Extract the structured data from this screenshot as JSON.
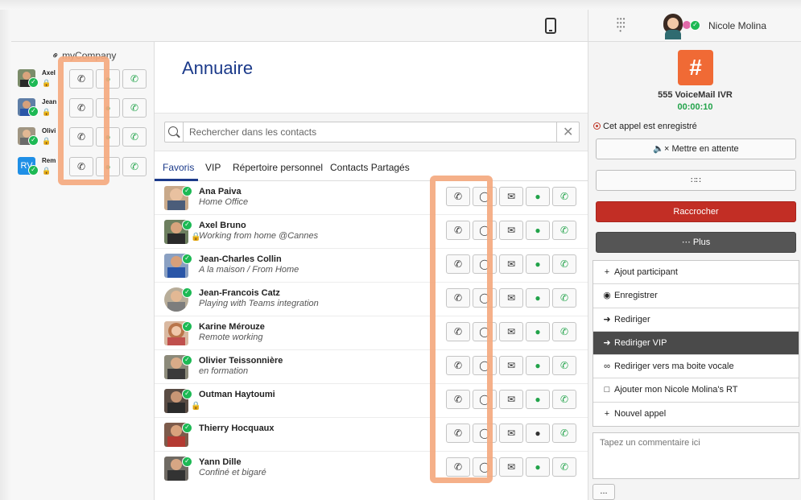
{
  "topbar": {
    "user_name": "Nicole Molina"
  },
  "left_panel": {
    "company": "myCompany",
    "users": [
      {
        "name": "Axel"
      },
      {
        "name": "Jean"
      },
      {
        "name": "Olivi"
      },
      {
        "name": "Rem",
        "initials": "RV"
      }
    ]
  },
  "directory": {
    "title": "Annuaire",
    "search_placeholder": "Rechercher dans les contacts",
    "tabs": [
      "Favoris",
      "VIP",
      "Répertoire personnel",
      "Contacts Partagés"
    ],
    "contacts": [
      {
        "name": "Ana Paiva",
        "status": "Home Office"
      },
      {
        "name": "Axel Bruno",
        "status": "Working from home @Cannes"
      },
      {
        "name": "Jean-Charles Collin",
        "status": "A la maison / From Home"
      },
      {
        "name": "Jean-Francois Catz",
        "status": "Playing with Teams integration"
      },
      {
        "name": "Karine Mérouze",
        "status": "Remote working"
      },
      {
        "name": "Olivier Teissonnière",
        "status": "en formation"
      },
      {
        "name": "Outman Haytoumi",
        "status": ""
      },
      {
        "name": "Thierry Hocquaux",
        "status": ""
      },
      {
        "name": "Yann Dille",
        "status": "Confiné et bigaré"
      }
    ]
  },
  "call_panel": {
    "caller_name": "555 VoiceMail IVR",
    "timer": "00:00:10",
    "recording_note": "Cet appel est enregistré",
    "hold_label": "Mettre en attente",
    "hangup_label": "Raccrocher",
    "more_label": "Plus",
    "menu": [
      "Ajout participant",
      "Enregistrer",
      "Rediriger",
      "Rediriger VIP",
      "Rediriger vers ma boite vocale",
      "Ajouter mon Nicole Molina's RT",
      "Nouvel appel"
    ],
    "comment_placeholder": "Tapez un commentaire ici",
    "ellipsis_label": "...",
    "badge_symbol": "#"
  },
  "colors": {
    "accent_blue": "#1b3a8a",
    "presence_green": "#1db954",
    "hangup_red": "#c22e25",
    "ivr_orange": "#f06a35",
    "highlight": "#f4a97f"
  }
}
